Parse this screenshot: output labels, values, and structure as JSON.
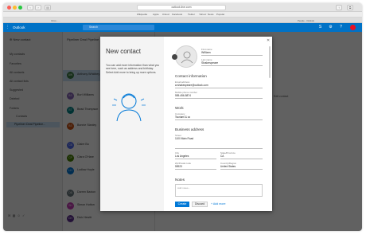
{
  "browser": {
    "url": "outlook.live.com",
    "bookmarks": [
      "Wikipedia",
      "Apple",
      "iCloud",
      "Facebook",
      "Twitter",
      "Yahoo!",
      "News",
      "Popular"
    ],
    "tabs": [
      "Inbox - ...",
      "People - Outlook"
    ]
  },
  "app": {
    "title": "Outlook",
    "search_placeholder": "Search"
  },
  "sidebar": {
    "new_contact_label": "New contact",
    "items": [
      "My contacts",
      "Favorites",
      "All contacts",
      "All contact lists",
      "Suggested",
      "Deleted",
      "Folders",
      "Contacts"
    ],
    "selected": "Pipeliner Deal Pipeline..."
  },
  "list": {
    "header": "Pipeliner Deal Pipeline",
    "contacts": [
      {
        "initials": "AW",
        "name": "Anthony Whidbey",
        "sub": ""
      },
      {
        "initials": "BS",
        "name": "Burt Williams",
        "sub": ""
      },
      {
        "initials": "BT",
        "name": "Bead Thompson",
        "sub": ""
      },
      {
        "initials": "BS",
        "name": "Bonnie Stanley",
        "sub": ""
      },
      {
        "initials": "CB",
        "name": "Claire Bu",
        "sub": ""
      },
      {
        "initials": "CP",
        "name": "Clara O'Hare",
        "sub": ""
      },
      {
        "initials": "LH",
        "name": "Ludlow Hoyle",
        "sub": ""
      },
      {
        "initials": "DB",
        "name": "Darren Baxton",
        "sub": ""
      },
      {
        "initials": "SH",
        "name": "Simon Hutton",
        "sub": ""
      },
      {
        "initials": "DH",
        "name": "Dick Hewitt",
        "sub": ""
      }
    ]
  },
  "detail": {
    "edit_label": "Edit contact"
  },
  "dialog": {
    "title": "New contact",
    "intro": "You can add more information than what you see here, such as address and birthday. Select Add more to bring up more options.",
    "first_name_label": "First name",
    "first_name": "William",
    "last_name_label": "Last name",
    "last_name": "Shakespeare",
    "contact_info_heading": "Contact information",
    "email_label": "Email address",
    "email": "w.shakespeare@outlook.com",
    "mobile_label": "Mobile phone number",
    "mobile": "555-456-5874",
    "work_heading": "Work",
    "company_label": "Company",
    "company": "Tsunami & co",
    "address_heading": "Business address",
    "street_label": "Street",
    "street": "1100 Main Road",
    "city_label": "City",
    "city": "Los Angeles",
    "state_label": "State/Province",
    "state": "CA",
    "zip_label": "Zip/Postal code",
    "zip": "55923",
    "country_label": "Country/Region",
    "country": "United States",
    "notes_heading": "Notes",
    "notes_placeholder": "Add notes...",
    "create_label": "Create",
    "discard_label": "Discard",
    "add_more_label": "+ Add more"
  }
}
